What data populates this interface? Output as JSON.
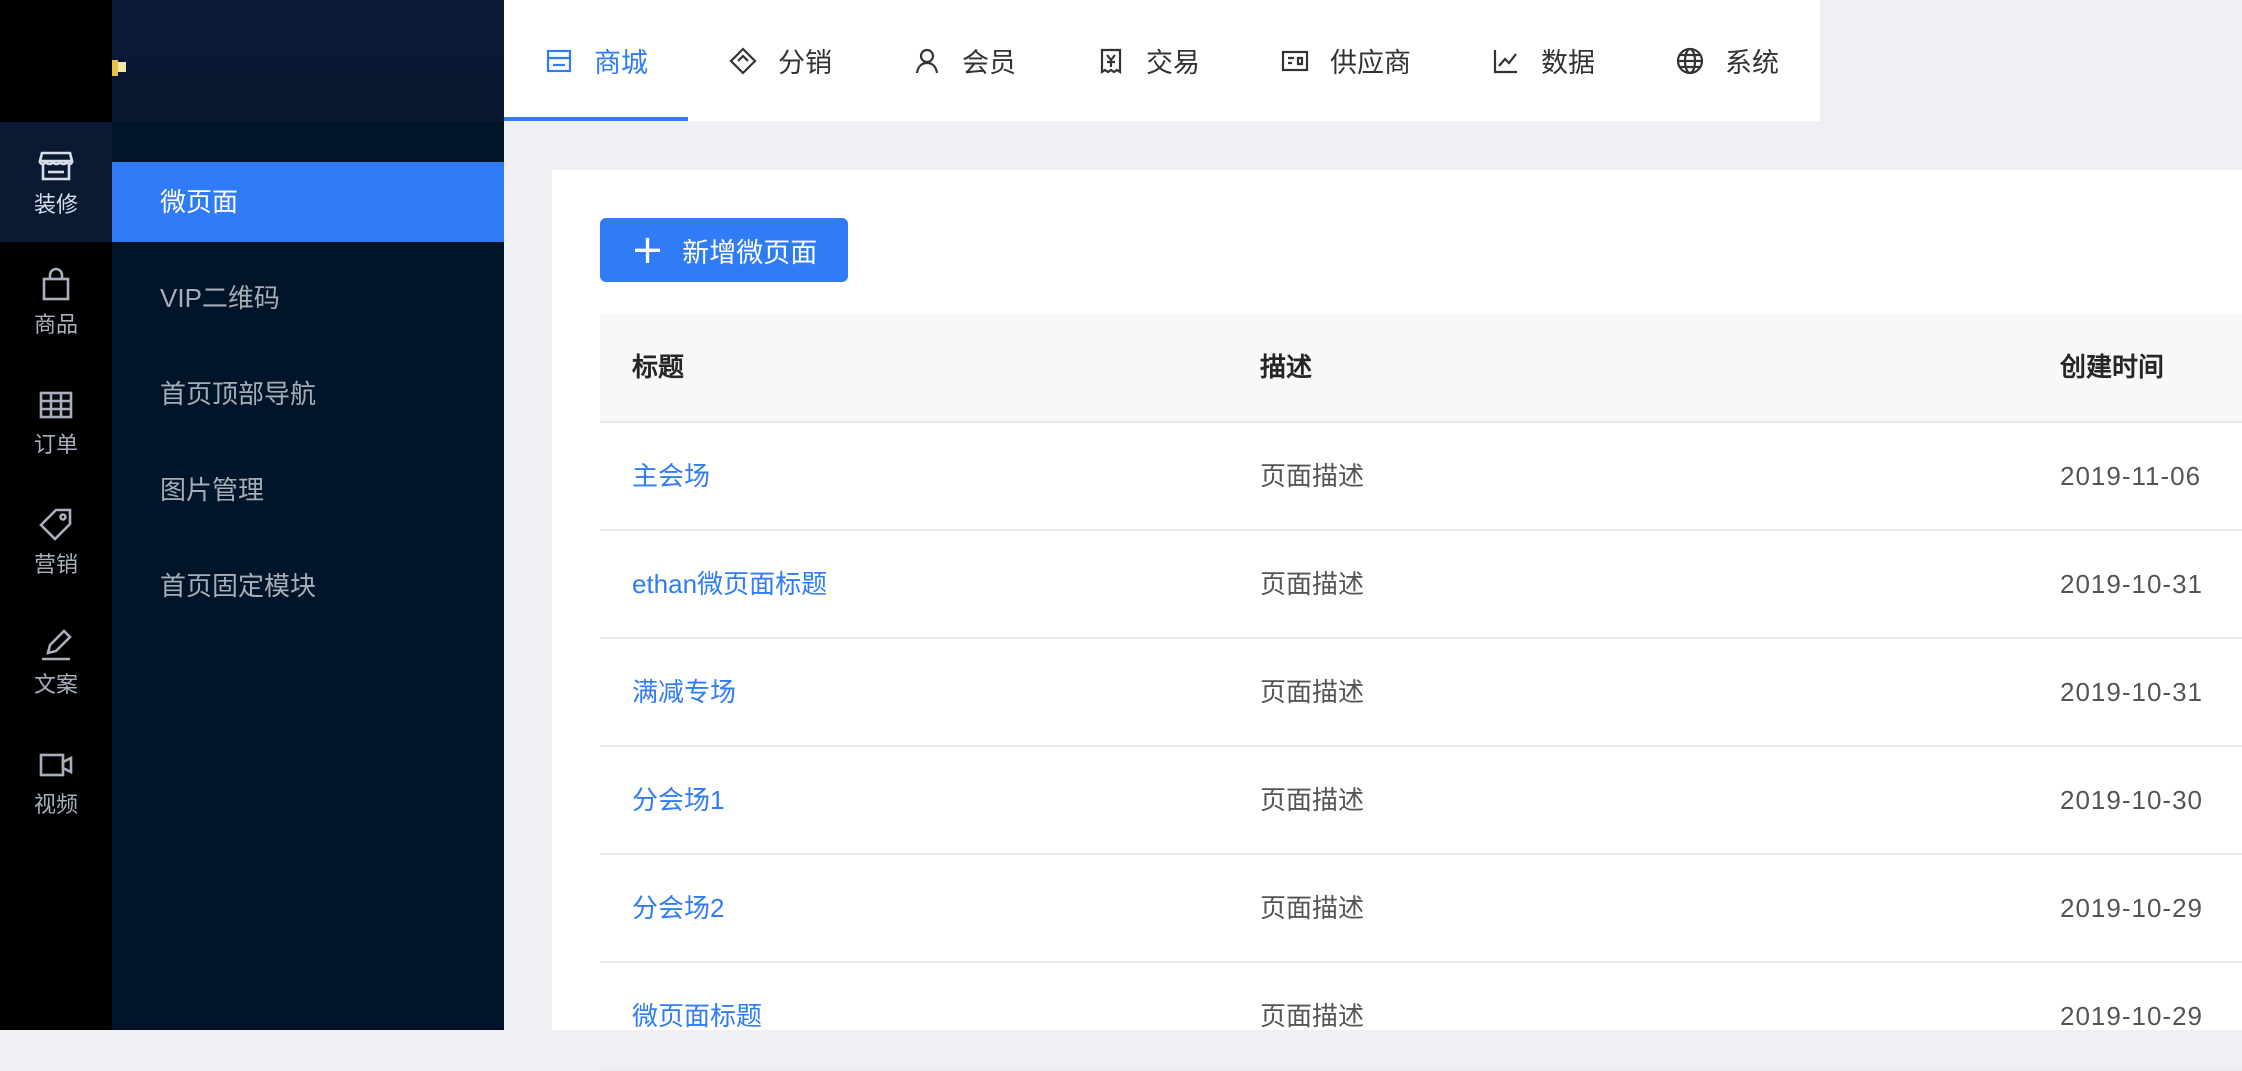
{
  "rail": {
    "items": [
      {
        "label": "装修",
        "icon": "store-icon",
        "active": true
      },
      {
        "label": "商品",
        "icon": "shopping-bag-icon",
        "active": false
      },
      {
        "label": "订单",
        "icon": "grid-table-icon",
        "active": false
      },
      {
        "label": "营销",
        "icon": "tag-icon",
        "active": false
      },
      {
        "label": "文案",
        "icon": "pen-icon",
        "active": false
      },
      {
        "label": "视频",
        "icon": "video-camera-icon",
        "active": false
      }
    ]
  },
  "subnav": {
    "items": [
      {
        "label": "微页面",
        "active": true
      },
      {
        "label": "VIP二维码",
        "active": false
      },
      {
        "label": "首页顶部导航",
        "active": false
      },
      {
        "label": "图片管理",
        "active": false
      },
      {
        "label": "首页固定模块",
        "active": false
      }
    ]
  },
  "topnav": {
    "tabs": [
      {
        "label": "商城",
        "icon": "store-icon",
        "active": true
      },
      {
        "label": "分销",
        "icon": "diamond-icon",
        "active": false
      },
      {
        "label": "会员",
        "icon": "user-icon",
        "active": false
      },
      {
        "label": "交易",
        "icon": "yen-receipt-icon",
        "active": false
      },
      {
        "label": "供应商",
        "icon": "id-card-icon",
        "active": false
      },
      {
        "label": "数据",
        "icon": "line-chart-icon",
        "active": false
      },
      {
        "label": "系统",
        "icon": "globe-icon",
        "active": false
      }
    ]
  },
  "main": {
    "add_button_label": "新增微页面",
    "table": {
      "headers": {
        "title": "标题",
        "description": "描述",
        "created": "创建时间"
      },
      "rows": [
        {
          "title": "主会场",
          "description": "页面描述",
          "created": "2019-11-06"
        },
        {
          "title": "ethan微页面标题",
          "description": "页面描述",
          "created": "2019-10-31"
        },
        {
          "title": "满减专场",
          "description": "页面描述",
          "created": "2019-10-31"
        },
        {
          "title": "分会场1",
          "description": "页面描述",
          "created": "2019-10-30"
        },
        {
          "title": "分会场2",
          "description": "页面描述",
          "created": "2019-10-29"
        },
        {
          "title": "微页面标题",
          "description": "页面描述",
          "created": "2019-10-29"
        }
      ]
    }
  },
  "colors": {
    "accent": "#2f7cf6",
    "sidebar_bg": "#001529",
    "rail_bg": "#000000",
    "header_bg": "#0c1a36"
  }
}
